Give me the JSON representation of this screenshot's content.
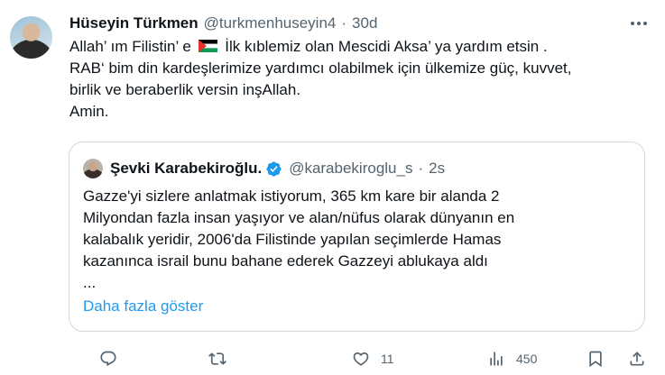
{
  "tweet": {
    "author_name": "Hüseyin Türkmen",
    "author_handle": "@turkmenhuseyin4",
    "separator": "·",
    "time": "30d",
    "lines": [
      "Allah’ ım Filistin’ e",
      "İlk kıblemiz olan Mescidi Aksa’ ya yardım etsin .",
      "RAB‘ bim din kardeşlerimize yardımcı olabilmek için ülkemize güç, kuvvet,",
      "birlik ve beraberlik versin inşAllah.",
      "Amin."
    ]
  },
  "quote": {
    "author_name": "Şevki Karabekiroğlu.",
    "author_handle": "@karabekiroglu_s",
    "separator": "·",
    "time": "2s",
    "lines": [
      "Gazze'yi sizlere anlatmak istiyorum, 365 km kare bir alanda 2",
      "Milyondan fazla insan yaşıyor ve alan/nüfus olarak dünyanın en",
      "kalabalık yeridir, 2006'da Filistinde yapılan seçimlerde Hamas",
      "kazanınca israil bunu bahane ederek Gazzeyi ablukaya aldı",
      "..."
    ],
    "show_more": "Daha fazla göster"
  },
  "actions": {
    "retweets": "",
    "likes": "11",
    "views": "450"
  },
  "colors": {
    "text": "#0f1419",
    "muted": "#536471",
    "link": "#1d9bf0",
    "border": "#cfd9de"
  }
}
